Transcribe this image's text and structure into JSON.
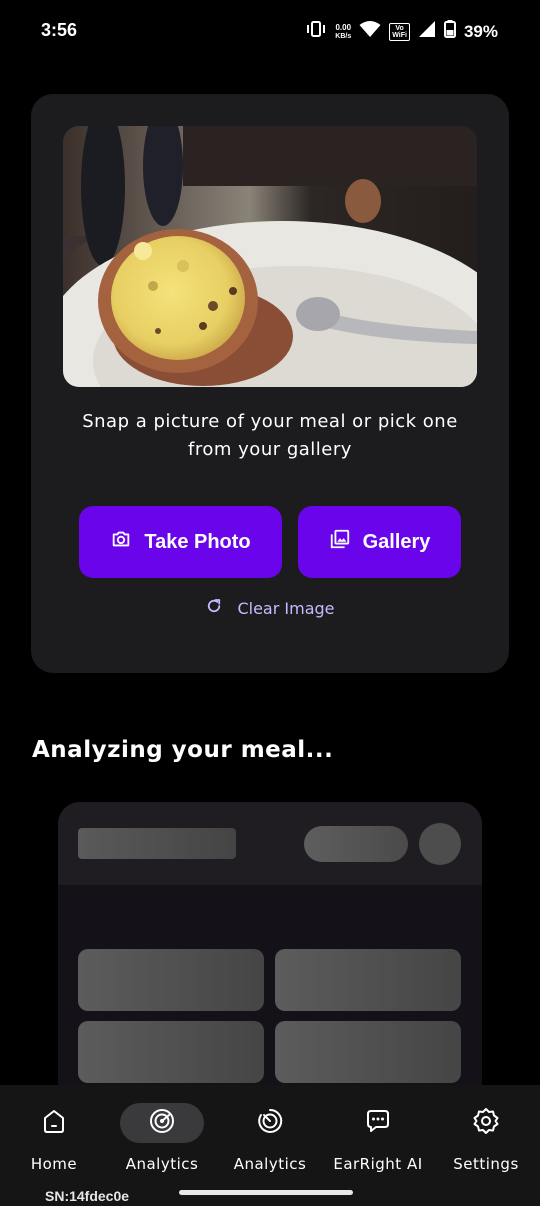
{
  "status_bar": {
    "time": "3:56",
    "net_speed_value": "0.00",
    "net_speed_unit": "KB/s",
    "vowifi_top": "Vo",
    "vowifi_bottom": "WiFi",
    "battery": "39%",
    "icons": [
      "vibrate-icon",
      "wifi-icon",
      "signal-icon",
      "battery-icon"
    ]
  },
  "capture": {
    "prompt": "Snap a picture of your meal or pick one from your gallery",
    "take_photo_label": "Take Photo",
    "gallery_label": "Gallery",
    "clear_label": "Clear Image",
    "accent_color": "#6a04ea"
  },
  "analysis": {
    "title": "Analyzing your meal..."
  },
  "nav": {
    "items": [
      {
        "label": "Home",
        "icon": "home-icon",
        "active": false
      },
      {
        "label": "Analytics",
        "icon": "analytics-icon",
        "active": true
      },
      {
        "label": "Analytics",
        "icon": "analytics-alt-icon",
        "active": false
      },
      {
        "label": "EarRight AI",
        "icon": "chat-icon",
        "active": false
      },
      {
        "label": "Settings",
        "icon": "gear-icon",
        "active": false
      }
    ]
  },
  "footer": {
    "serial": "SN:14fdec0e"
  }
}
